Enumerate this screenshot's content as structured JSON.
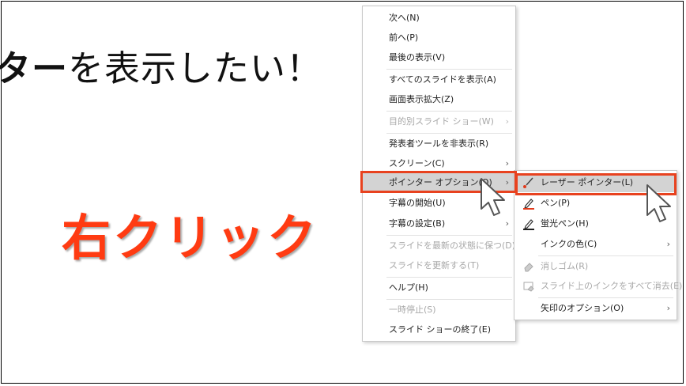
{
  "slide": {
    "heading_bold": "ター",
    "heading_rest": "を表示したい！",
    "callout": "右クリック"
  },
  "main_menu": [
    {
      "label": "次へ(N)",
      "disabled": false
    },
    {
      "label": "前へ(P)",
      "disabled": false
    },
    {
      "label": "最後の表示(V)",
      "disabled": false
    },
    {
      "label": "すべてのスライドを表示(A)",
      "disabled": false
    },
    {
      "label": "画面表示拡大(Z)",
      "disabled": false
    },
    {
      "label": "目的別スライド ショー(W)",
      "disabled": true
    },
    {
      "label": "発表者ツールを非表示(R)",
      "disabled": false
    },
    {
      "label": "スクリーン(C)",
      "disabled": false
    },
    {
      "label": "ポインター オプション(O)",
      "disabled": false
    },
    {
      "label": "字幕の開始(U)",
      "disabled": false
    },
    {
      "label": "字幕の設定(B)",
      "disabled": false
    },
    {
      "label": "スライドを最新の状態に保つ(D)",
      "disabled": true
    },
    {
      "label": "スライドを更新する(T)",
      "disabled": true
    },
    {
      "label": "ヘルプ(H)",
      "disabled": false
    },
    {
      "label": "一時停止(S)",
      "disabled": true
    },
    {
      "label": "スライド ショーの終了(E)",
      "disabled": false
    }
  ],
  "sub_menu": [
    {
      "label": "レーザー ポインター(L)",
      "icon": "laser-pointer-icon",
      "disabled": false
    },
    {
      "label": "ペン(P)",
      "icon": "pen-icon",
      "disabled": false
    },
    {
      "label": "蛍光ペン(H)",
      "icon": "highlighter-icon",
      "disabled": false
    },
    {
      "label": "インクの色(C)",
      "icon": "",
      "disabled": false
    },
    {
      "label": "消しゴム(R)",
      "icon": "eraser-icon",
      "disabled": true
    },
    {
      "label": "スライド上のインクをすべて消去(E)",
      "icon": "erase-all-ink-icon",
      "disabled": true
    },
    {
      "label": "矢印のオプション(O)",
      "icon": "",
      "disabled": false
    }
  ],
  "submenu_arrow": "›",
  "colors": {
    "callout": "#ff3b12",
    "highlight_box": "#e8421f"
  }
}
